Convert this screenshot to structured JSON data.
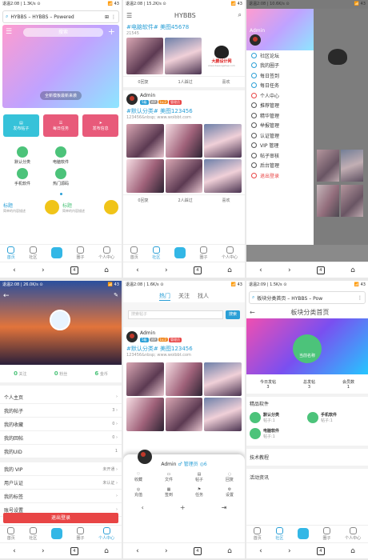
{
  "colors": {
    "accent": "#2a9fd6",
    "green": "#4cc37a",
    "red": "#e84545",
    "orange": "#f08a24"
  },
  "p1": {
    "status_left": "退温2:08 | 1.3K/s ⊙",
    "status_right": "📶 43",
    "url": "HYBBS – HYBBS – Powered",
    "search_placeholder": "搜索",
    "banner_caption": "全新模板最新来袭",
    "actions": [
      {
        "label": "发布帖子",
        "color": "#36c2d9"
      },
      {
        "label": "每日任务",
        "color": "#e85a7a"
      },
      {
        "label": "发布信息",
        "color": "#e85a7a"
      }
    ],
    "forums": [
      {
        "label": "默认分类"
      },
      {
        "label": "电脑软件"
      },
      {
        "label": "手机软件"
      },
      {
        "label": "热门源码"
      }
    ],
    "notices": [
      {
        "title": "标题",
        "desc": "简单的内容描述"
      },
      {
        "title": "标题",
        "desc": "简单的内容描述"
      }
    ],
    "nav": [
      "首页",
      "社区",
      "",
      "圈子",
      "个人中心"
    ],
    "tabs": "4"
  },
  "p2": {
    "status_left": "退温2:08 | 15.2K/s ⊙",
    "status_right": "📶 43",
    "title": "HYBBS",
    "post1_title": "#电脑软件# 美图45678",
    "post1_sub": "21545",
    "logo_text": "大鹏设计网",
    "logo_url": "www.dapengsheji.com",
    "actions1": [
      "0回复",
      "1人踩过",
      "喜欢"
    ],
    "author": "Admin",
    "tags": [
      "5级",
      "VIP",
      "Lv.2",
      "管理员"
    ],
    "post2_title": "#默认分类# 美图123456",
    "post2_sub": "123456&nbsp; www.woibbt.com",
    "actions2": [
      "0回复",
      "2人踩过",
      "喜欢"
    ],
    "nav": [
      "首页",
      "社区",
      "",
      "圈子",
      "个人中心"
    ],
    "tabs": "4"
  },
  "p3": {
    "status_left": "退温2:08 | 10.6K/s ⊙",
    "status_right": "📶 43",
    "user": "Admin",
    "menu": [
      "社区论坛",
      "我的圈子",
      "每日签到",
      "每日任务",
      "个人中心",
      "推荐管理",
      "精华管理",
      "举报管理",
      "认证管理",
      "VIP 管理",
      "帖子审核",
      "后台管理",
      "退出登录"
    ],
    "tabs": "4"
  },
  "p4": {
    "status_left": "退温2:08 | 26.0K/s ⊙",
    "status_right": "📶 43",
    "stats": [
      {
        "value": "0",
        "label": "关注"
      },
      {
        "value": "0",
        "label": "粉丝"
      },
      {
        "value": "6",
        "label": "金币"
      }
    ],
    "rows": [
      {
        "label": "个人主页",
        "value": ""
      },
      {
        "label": "我的帖子",
        "value": "3"
      },
      {
        "label": "我的收藏",
        "value": "0"
      },
      {
        "label": "我的回帖",
        "value": "0"
      },
      {
        "label": "我的UID",
        "value": "1"
      },
      {
        "label": "我的 VIP",
        "value": "未开通"
      },
      {
        "label": "用户认证",
        "value": "未认证"
      },
      {
        "label": "我的标签",
        "value": ""
      },
      {
        "label": "账号设置",
        "value": ""
      }
    ],
    "logout": "退出登录",
    "nav": [
      "首页",
      "社区",
      "",
      "圈子",
      "个人中心"
    ],
    "tabs": "4"
  },
  "p5": {
    "status_left": "退温2:08 | 1.6K/s ⊙",
    "status_right": "📶 43",
    "tabs_top": [
      "热门",
      "关注",
      "找人"
    ],
    "search_placeholder": "搜索帖子",
    "search_btn": "搜索",
    "author": "Admin",
    "tags": [
      "5级",
      "VIP",
      "Lv.2",
      "管理员"
    ],
    "post_title": "#默认分类# 美图123456",
    "post_sub": "123456&nbsp; www.woibbt.com",
    "popup_user": "Admin",
    "popup_role": "♂ 管理员 ◎6",
    "popup_items": [
      "收藏",
      "文件",
      "帖子",
      "回复",
      "充值",
      "签到",
      "任务",
      "设置"
    ],
    "tabs": "4"
  },
  "p6": {
    "status_left": "退温2:09 | 1.5K/s ⊙",
    "status_right": "📶 43",
    "url": "板块分类首页 – HYBBS – Pow",
    "title": "板块分类首页",
    "badge": "当前名称",
    "stats": [
      {
        "label": "今日发帖",
        "value": "3"
      },
      {
        "label": "总发帖",
        "value": "3"
      },
      {
        "label": "会员数",
        "value": "1"
      }
    ],
    "section1": "精品软件",
    "cats": [
      {
        "name": "默认分类",
        "count": "帖子:1"
      },
      {
        "name": "手机软件",
        "count": "帖子:1"
      },
      {
        "name": "电脑软件",
        "count": "帖子:1"
      }
    ],
    "section2": "技术教程",
    "section3": "活动资讯",
    "nav": [
      "首页",
      "社区",
      "",
      "圈子",
      "个人中心"
    ],
    "tabs": "4"
  }
}
